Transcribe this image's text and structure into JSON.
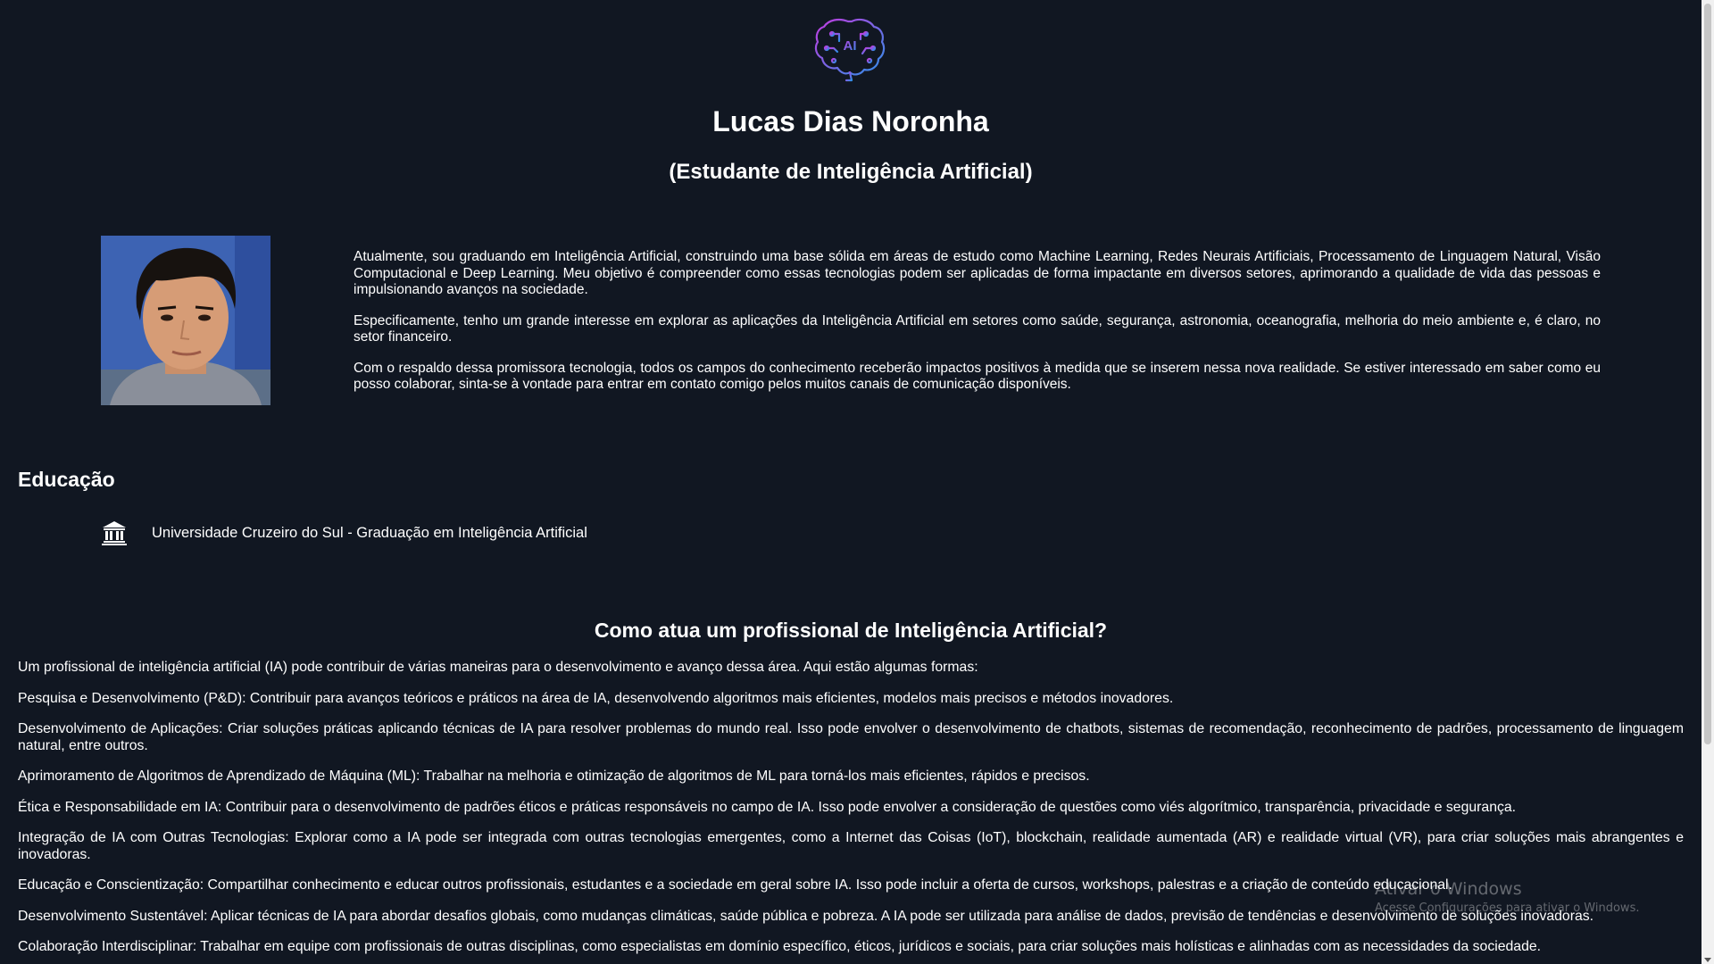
{
  "header": {
    "logo_icon": "ai-brain-icon",
    "logo_text": "AI",
    "name": "Lucas Dias Noronha",
    "subtitle": "(Estudante de Inteligência Artificial)"
  },
  "profile": {
    "photo_icon": "profile-photo",
    "paragraphs": [
      "Atualmente, sou graduando em Inteligência Artificial, construindo uma base sólida em áreas de estudo como Machine Learning, Redes Neurais Artificiais, Processamento de Linguagem Natural, Visão Computacional e Deep Learning. Meu objetivo é compreender como essas tecnologias podem ser aplicadas de forma impactante em diversos setores, aprimorando a qualidade de vida das pessoas e impulsionando avanços na sociedade.",
      "Especificamente, tenho um grande interesse em explorar as aplicações da Inteligência Artificial em setores como saúde, segurança, astronomia, oceanografia, melhoria do meio ambiente e, é claro, no setor financeiro.",
      "Com o respaldo dessa promissora tecnologia, todos os campos do conhecimento receberão impactos positivos à medida que se inserem nessa nova realidade. Se estiver interessado em saber como eu posso colaborar, sinta-se à vontade para entrar em contato comigo pelos muitos canais de comunicação disponíveis."
    ]
  },
  "education": {
    "title": "Educação",
    "icon": "university-icon",
    "item": "Universidade Cruzeiro do Sul - Graduação em Inteligência Artificial"
  },
  "role_section": {
    "title": "Como atua um profissional de Inteligência Artificial?",
    "paragraphs": [
      "Um profissional de inteligência artificial (IA) pode contribuir de várias maneiras para o desenvolvimento e avanço dessa área. Aqui estão algumas formas:",
      "Pesquisa e Desenvolvimento (P&D): Contribuir para avanços teóricos e práticos na área de IA, desenvolvendo algoritmos mais eficientes, modelos mais precisos e métodos inovadores.",
      "Desenvolvimento de Aplicações: Criar soluções práticas aplicando técnicas de IA para resolver problemas do mundo real. Isso pode envolver o desenvolvimento de chatbots, sistemas de recomendação, reconhecimento de padrões, processamento de linguagem natural, entre outros.",
      "Aprimoramento de Algoritmos de Aprendizado de Máquina (ML): Trabalhar na melhoria e otimização de algoritmos de ML para torná-los mais eficientes, rápidos e precisos.",
      "Ética e Responsabilidade em IA: Contribuir para o desenvolvimento de padrões éticos e práticas responsáveis no campo de IA. Isso pode envolver a consideração de questões como viés algorítmico, transparência, privacidade e segurança.",
      "Integração de IA com Outras Tecnologias: Explorar como a IA pode ser integrada com outras tecnologias emergentes, como a Internet das Coisas (IoT), blockchain, realidade aumentada (AR) e realidade virtual (VR), para criar soluções mais abrangentes e inovadoras.",
      "Educação e Conscientização: Compartilhar conhecimento e educar outros profissionais, estudantes e a sociedade em geral sobre IA. Isso pode incluir a oferta de cursos, workshops, palestras e a criação de conteúdo educacional.",
      "Desenvolvimento Sustentável: Aplicar técnicas de IA para abordar desafios globais, como mudanças climáticas, saúde pública e pobreza. A IA pode ser utilizada para análise de dados, previsão de tendências e desenvolvimento de soluções inovadoras.",
      "Colaboração Interdisciplinar: Trabalhar em equipe com profissionais de outras disciplinas, como especialistas em domínio específico, éticos, jurídicos e sociais, para criar soluções mais holísticas e alinhadas com as necessidades da sociedade."
    ]
  },
  "watermark": {
    "title": "Ativar o Windows",
    "subtitle": "Acesse Configurações para ativar o Windows."
  },
  "colors": {
    "background": "#111722",
    "text": "#ffffff",
    "logo_gradient_start": "#c13ce0",
    "logo_gradient_end": "#2f8fe8"
  }
}
